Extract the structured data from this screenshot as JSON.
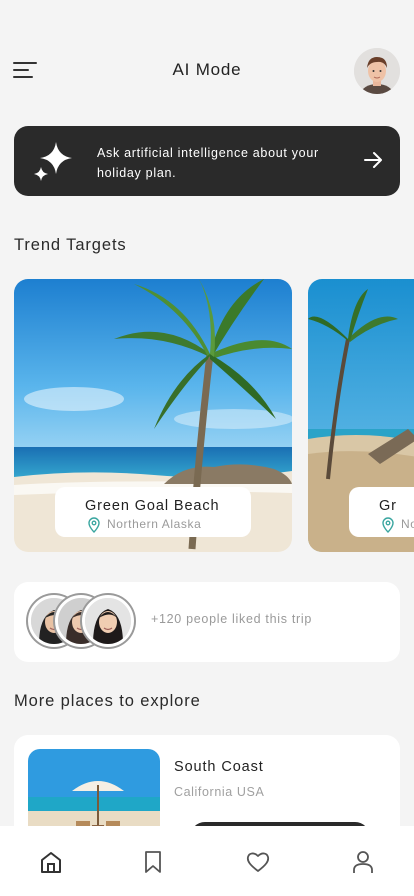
{
  "header": {
    "title": "AI Mode"
  },
  "ai_prompt": {
    "text": "Ask artificial intelligence about your holiday plan.",
    "icon": "sparkle-icon",
    "action_icon": "arrow-right-icon"
  },
  "trend": {
    "section_title": "Trend Targets",
    "cards": [
      {
        "name": "Green Goal Beach",
        "location": "Northern Alaska"
      },
      {
        "name": "Gr",
        "location": "Nor"
      }
    ]
  },
  "likes": {
    "text": "+120 people liked this trip"
  },
  "explore": {
    "section_title": "More places to explore",
    "places": [
      {
        "name": "South Coast",
        "location": "California USA"
      }
    ]
  },
  "tabbar": {
    "items": [
      "home-icon",
      "bookmark-icon",
      "heart-icon",
      "user-icon"
    ],
    "active": "home-icon"
  },
  "colors": {
    "background": "#f4f4f4",
    "dark_card": "#2a2a2a",
    "accent_teal": "#3aa6a0",
    "muted_text": "#9a9a9a"
  }
}
